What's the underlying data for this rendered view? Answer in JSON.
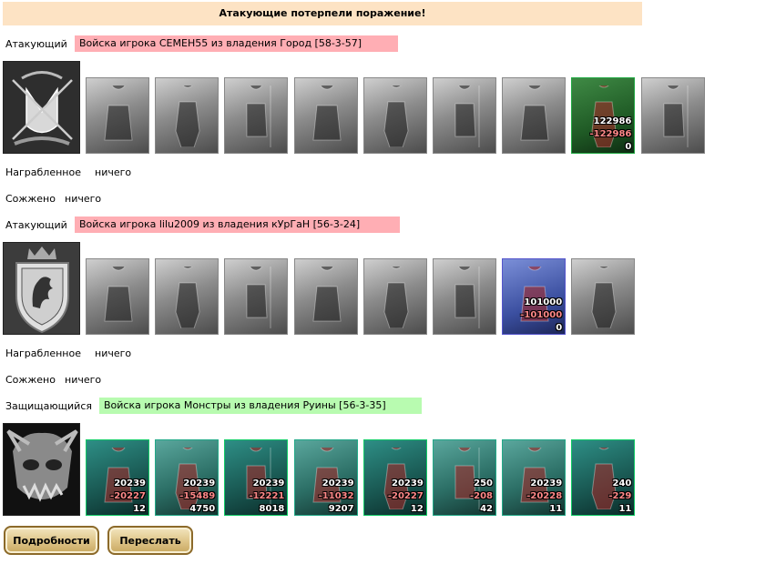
{
  "banner": "Атакующие потерпели поражение!",
  "groups": [
    {
      "role": "Атакующий",
      "army": "Войска игрока СЕМЕН55 из владения Город [58-3-57]",
      "loot_label": "Награбленное",
      "loot_value": "ничего",
      "burned_label": "Сожжено",
      "burned_value": "ничего",
      "units": [
        {
          "icon": "dwarf-unit-icon"
        },
        {
          "icon": "swordsman-unit-icon"
        },
        {
          "icon": "spearman-unit-icon"
        },
        {
          "icon": "griffin-unit-icon"
        },
        {
          "icon": "archer-unit-icon"
        },
        {
          "icon": "monk-unit-icon"
        },
        {
          "icon": "priest-unit-icon"
        },
        {
          "icon": "druid-unit-icon",
          "total": "122986",
          "loss": "-122986",
          "left": "0"
        },
        {
          "icon": "elder-unit-icon"
        }
      ]
    },
    {
      "role": "Атакующий",
      "army": "Войска игрока lilu2009 из владения кУрГаН [56-3-24]",
      "loot_label": "Награбленное",
      "loot_value": "ничего",
      "burned_label": "Сожжено",
      "burned_value": "ничего",
      "units": [
        {
          "icon": "donkey-rider-unit-icon"
        },
        {
          "icon": "halberdier-unit-icon"
        },
        {
          "icon": "cavalry-unit-icon"
        },
        {
          "icon": "pegasus-unit-icon"
        },
        {
          "icon": "crossbowman-unit-icon"
        },
        {
          "icon": "hooded-unit-icon"
        },
        {
          "icon": "swordmaster-unit-icon",
          "total": "101000",
          "loss": "-101000",
          "left": "0"
        },
        {
          "icon": "ghost-unit-icon"
        }
      ]
    },
    {
      "role": "Защищающийся",
      "army": "Войска игрока Монстры из владения Руины [56-3-35]",
      "units": [
        {
          "icon": "lizard-unit-icon",
          "total": "20239",
          "loss": "-20227",
          "left": "12"
        },
        {
          "icon": "ogre-unit-icon",
          "total": "20239",
          "loss": "-15489",
          "left": "4750"
        },
        {
          "icon": "orc-unit-icon",
          "total": "20239",
          "loss": "-12221",
          "left": "8018"
        },
        {
          "icon": "demon-unit-icon",
          "total": "20239",
          "loss": "-11032",
          "left": "9207"
        },
        {
          "icon": "spider-unit-icon",
          "total": "20239",
          "loss": "-20227",
          "left": "12"
        },
        {
          "icon": "imp-unit-icon",
          "total": "250",
          "loss": "-208",
          "left": "42"
        },
        {
          "icon": "golem-unit-icon",
          "total": "20239",
          "loss": "-20228",
          "left": "11"
        },
        {
          "icon": "sorceress-unit-icon",
          "total": "240",
          "loss": "-229",
          "left": "11"
        }
      ]
    }
  ],
  "buttons": {
    "details": "Подробности",
    "forward": "Переслать"
  },
  "colors": {
    "banner": "#fde3c4",
    "attacker": "#ffaeb4",
    "defender": "#b8fbb0",
    "button": "#e0c78c"
  }
}
